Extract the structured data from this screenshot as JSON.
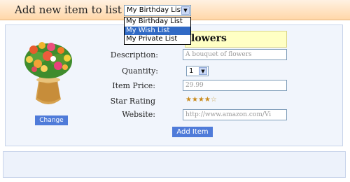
{
  "header": {
    "label": "Add new item to list :",
    "selected_list": "My Birthday List",
    "list_options": [
      "My Birthday List",
      "My Wish List",
      "My Private List"
    ],
    "highlighted_option_index": 1
  },
  "item": {
    "title_visible": "lowers",
    "description_placeholder": "A bouquet of flowers",
    "quantity_value": "1",
    "price_placeholder": "29.99",
    "rating": 4,
    "rating_max": 5,
    "website_placeholder": "http://www.amazon.com/Vi"
  },
  "form_labels": {
    "description": "Description:",
    "quantity": "Quantity:",
    "price": "Item Price:",
    "rating": "Star Rating",
    "website": "Website:"
  },
  "buttons": {
    "change": "Change",
    "add_item": "Add Item"
  },
  "icons": {
    "item_image": "flower-bouquet-image",
    "dropdown_arrow": "chevron-down-icon",
    "rating_star": "star-icon"
  },
  "colors": {
    "header_gradient_top": "#fff1e2",
    "header_gradient_bottom": "#ffd7a8",
    "button_blue": "#4f7bd9",
    "selection_blue": "#316ac5",
    "title_highlight": "#ffffc4",
    "star_gold": "#c98a1b"
  }
}
